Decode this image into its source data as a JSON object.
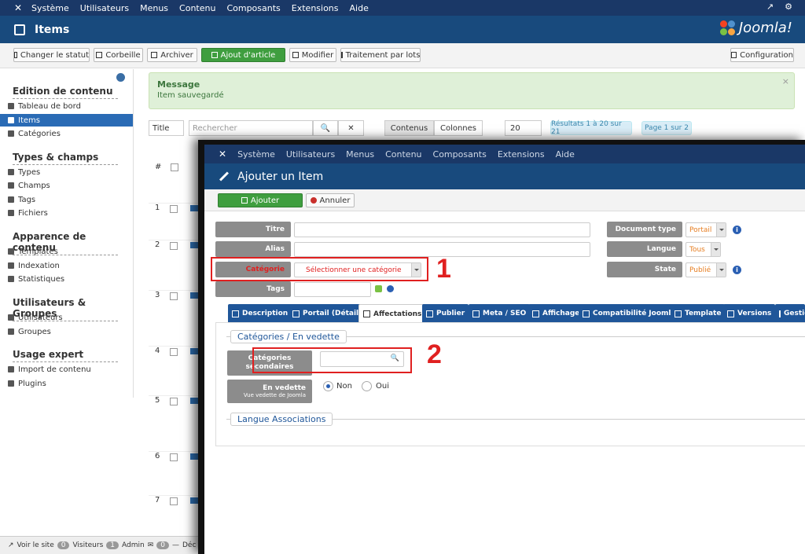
{
  "navbar": {
    "menu": [
      "Système",
      "Utilisateurs",
      "Menus",
      "Contenu",
      "Composants",
      "Extensions",
      "Aide"
    ],
    "right_user": "⚙"
  },
  "header": {
    "title": "Items",
    "brand": "Joomla!"
  },
  "toolbar": {
    "change_status": "Changer le statut",
    "trash": "Corbeille",
    "archive": "Archiver",
    "add_article": "Ajout d'article",
    "edit": "Modifier",
    "batch": "Traitement par lots",
    "config": "Configuration"
  },
  "sidebar": {
    "sections": [
      {
        "title": "Edition de contenu",
        "items": [
          "Tableau de bord",
          "Items",
          "Catégories"
        ]
      },
      {
        "title": "Types & champs",
        "items": [
          "Types",
          "Champs",
          "Tags",
          "Fichiers"
        ]
      },
      {
        "title": "Apparence de contenu",
        "items": [
          "Templates",
          "Indexation",
          "Statistiques"
        ]
      },
      {
        "title": "Utilisateurs & Groupes",
        "items": [
          "Utilisateurs",
          "Groupes"
        ]
      },
      {
        "title": "Usage expert",
        "items": [
          "Import de contenu",
          "Plugins"
        ]
      }
    ]
  },
  "message": {
    "title": "Message",
    "body": "Item sauvegardé"
  },
  "filters": {
    "title_select": "Title",
    "search_placeholder": "Rechercher",
    "tab_contents": "Contenus",
    "tab_columns": "Colonnes",
    "limit": "20",
    "results": "Résultats 1 à 20 sur 21",
    "page": "Page 1 sur 2"
  },
  "table": {
    "hash": "#",
    "rows": [
      "1",
      "2",
      "3",
      "4",
      "5",
      "6",
      "7"
    ]
  },
  "statusbar": {
    "view_site": "Voir le site",
    "visitors_count": "0",
    "visitors": "Visiteurs",
    "admin_count": "1",
    "admin": "Admin",
    "msg_count": "0",
    "disconnect": "Déc"
  },
  "overlay": {
    "menu": [
      "Système",
      "Utilisateurs",
      "Menus",
      "Contenu",
      "Composants",
      "Extensions",
      "Aide"
    ],
    "title": "Ajouter un Item",
    "add": "Ajouter",
    "cancel": "Annuler",
    "fields": {
      "title": "Titre",
      "alias": "Alias",
      "category": "Catégorie",
      "category_value": "Sélectionner une catégorie",
      "tags": "Tags",
      "doc_type": "Document type",
      "doc_type_value": "Portail",
      "language": "Langue",
      "language_value": "Tous",
      "state": "State",
      "state_value": "Publié"
    },
    "tabs": [
      "Description",
      "Portail (Détails)",
      "Affectations",
      "Publier",
      "Meta / SEO",
      "Affichage",
      "Compatibilité Joomla",
      "Template",
      "Versions",
      "Gestion"
    ],
    "section1": "Catégories / En vedette",
    "secondary_cats": "Catégories secondaires",
    "featured": "En vedette",
    "featured_sub": "Vue vedette de Joomla",
    "no": "Non",
    "yes": "Oui",
    "section2": "Langue Associations",
    "marker1": "1",
    "marker2": "2"
  }
}
